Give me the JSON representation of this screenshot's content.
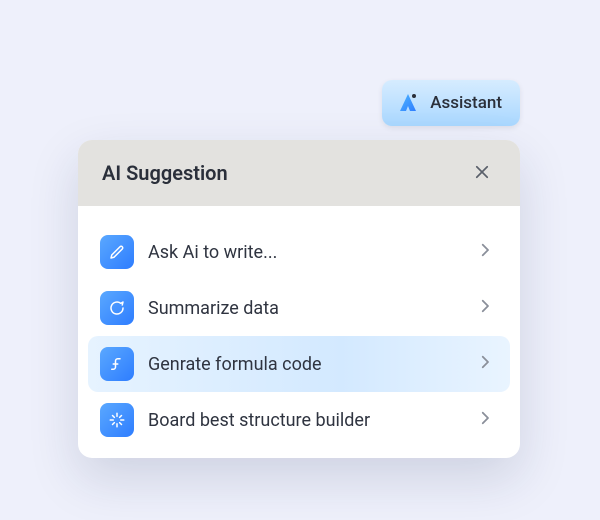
{
  "assistant": {
    "label": "Assistant"
  },
  "panel": {
    "title": "AI Suggestion"
  },
  "items": [
    {
      "label": "Ask Ai  to write...",
      "icon": "pencil-icon",
      "highlight": false
    },
    {
      "label": "Summarize data",
      "icon": "chat-icon",
      "highlight": false
    },
    {
      "label": "Genrate formula code",
      "icon": "function-icon",
      "highlight": true
    },
    {
      "label": "Board best structure builder",
      "icon": "sparkle-icon",
      "highlight": false
    }
  ],
  "colors": {
    "page_bg": "#eef0fb",
    "chip_grad_top": "#d6ecff",
    "chip_grad_bottom": "#a9d7ff",
    "header_bg": "#e3e2df",
    "icon_grad_start": "#5aa8ff",
    "icon_grad_end": "#2e7dff"
  }
}
